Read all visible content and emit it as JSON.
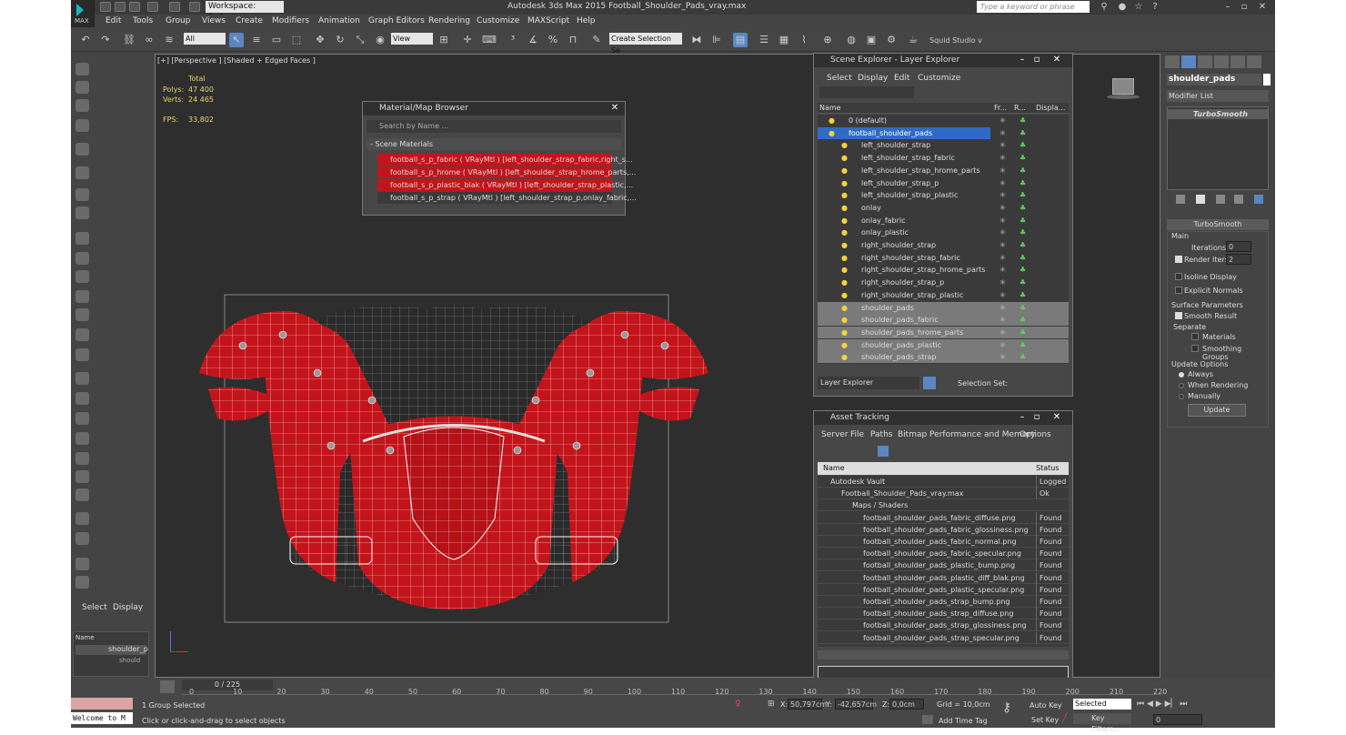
{
  "titlebar": {
    "workspace": "Workspace: Default",
    "title": "Autodesk 3ds Max  2015     Football_Shoulder_Pads_vray.max",
    "search_placeholder": "Type a keyword or phrase",
    "logo": "MAX"
  },
  "menu": [
    "Edit",
    "Tools",
    "Group",
    "Views",
    "Create",
    "Modifiers",
    "Animation",
    "Graph Editors",
    "Rendering",
    "Customize",
    "MAXScript",
    "Help"
  ],
  "toolbar": {
    "filter": "All",
    "view": "View",
    "selection_set": "Create Selection Se",
    "squid": "Squid Studio v"
  },
  "viewport": {
    "label": "[+] [Perspective ] [Shaded + Edged Faces ]",
    "stats": {
      "total_label": "Total",
      "polys_label": "Polys:",
      "polys": "47 400",
      "verts_label": "Verts:",
      "verts": "24 465",
      "fps_label": "FPS:",
      "fps": "33,802"
    }
  },
  "material_browser": {
    "title": "Material/Map Browser",
    "search_placeholder": "Search by Name ...",
    "section": "- Scene Materials",
    "items": [
      "football_s_p_fabric ( VRayMtl ) [left_shoulder_strap_fabric,right_s...",
      "football_s_p_hrome ( VRayMtl ) [left_shoulder_strap_hrome_parts,...",
      "football_s_p_plastic_blak ( VRayMtl ) [left_shoulder_strap_plastic,...",
      "football_s_p_strap ( VRayMtl ) [left_shoulder_strap_p,onlay_fabric,..."
    ]
  },
  "scene_explorer": {
    "title": "Scene Explorer - Layer Explorer",
    "menu": [
      "Select",
      "Display",
      "Edit",
      "Customize"
    ],
    "columns": [
      "Name",
      "Fr...",
      "R...",
      "Displa..."
    ],
    "rows": [
      "0 (default)",
      "football_shoulder_pads",
      "left_shoulder_strap",
      "left_shoulder_strap_fabric",
      "left_shoulder_strap_hrome_parts",
      "left_shoulder_strap_p",
      "left_shoulder_strap_plastic",
      "onlay",
      "onlay_fabric",
      "onlay_plastic",
      "right_shoulder_strap",
      "right_shoulder_strap_fabric",
      "right_shoulder_strap_hrome_parts",
      "right_shoulder_strap_p",
      "right_shoulder_strap_plastic",
      "shoulder_pads",
      "shoulder_pads_fabric",
      "shoulder_pads_hrome_parts",
      "shoulder_pads_plastic",
      "shoulder_pads_strap"
    ],
    "footer_left": "Layer Explorer",
    "footer_right": "Selection Set:"
  },
  "asset_tracking": {
    "title": "Asset Tracking",
    "menu": [
      "Server",
      "File",
      "Paths",
      "Bitmap Performance and Memory",
      "Options"
    ],
    "col_name": "Name",
    "col_status": "Status",
    "rows": [
      {
        "name": "Autodesk Vault",
        "status": "Logged C",
        "indent": 0
      },
      {
        "name": "Football_Shoulder_Pads_vray.max",
        "status": "Ok",
        "indent": 1
      },
      {
        "name": "Maps / Shaders",
        "status": "",
        "indent": 2
      },
      {
        "name": "football_shoulder_pads_fabric_diffuse.png",
        "status": "Found",
        "indent": 3
      },
      {
        "name": "football_shoulder_pads_fabric_glossiness.png",
        "status": "Found",
        "indent": 3
      },
      {
        "name": "football_shoulder_pads_fabric_normal.png",
        "status": "Found",
        "indent": 3
      },
      {
        "name": "football_shoulder_pads_fabric_specular.png",
        "status": "Found",
        "indent": 3
      },
      {
        "name": "football_shoulder_pads_plastic_bump.png",
        "status": "Found",
        "indent": 3
      },
      {
        "name": "football_shoulder_pads_plastic_diff_blak.png",
        "status": "Found",
        "indent": 3
      },
      {
        "name": "football_shoulder_pads_plastic_specular.png",
        "status": "Found",
        "indent": 3
      },
      {
        "name": "football_shoulder_pads_strap_bump.png",
        "status": "Found",
        "indent": 3
      },
      {
        "name": "football_shoulder_pads_strap_diffuse.png",
        "status": "Found",
        "indent": 3
      },
      {
        "name": "football_shoulder_pads_strap_glossiness.png",
        "status": "Found",
        "indent": 3
      },
      {
        "name": "football_shoulder_pads_strap_specular.png",
        "status": "Found",
        "indent": 3
      }
    ]
  },
  "modifier_panel": {
    "object_name": "shoulder_pads",
    "modifier_list": "Modifier List",
    "stack_item": "TurboSmooth",
    "rollout_title": "TurboSmooth",
    "main": "Main",
    "iterations_label": "Iterations:",
    "iterations": "0",
    "render_iters_label": "Render Iters:",
    "render_iters": "2",
    "isoline": "Isoline Display",
    "explicit": "Explicit Normals",
    "surface": "Surface Parameters",
    "smooth_result": "Smooth Result",
    "separate": "Separate",
    "materials": "Materials",
    "smoothing_groups": "Smoothing Groups",
    "update_options": "Update Options",
    "always": "Always",
    "when_rendering": "When Rendering",
    "manually": "Manually",
    "update": "Update"
  },
  "left_bottom": {
    "select": "Select",
    "display": "Display",
    "name_col": "Name",
    "item": "shoulder_p",
    "item2": "should"
  },
  "timeline": {
    "frame": "0 / 225",
    "ticks": [
      "0",
      "10",
      "20",
      "30",
      "40",
      "50",
      "60",
      "70",
      "80",
      "90",
      "100",
      "110",
      "120",
      "130",
      "140",
      "150",
      "160",
      "170",
      "180",
      "190",
      "200",
      "210",
      "220"
    ]
  },
  "status": {
    "selected": "1 Group Selected",
    "hint": "Click or click-and-drag to select objects",
    "welcome": "Welcome to M",
    "x": "50,797cm",
    "y": "-42,657cm",
    "z": "0,0cm",
    "grid": "Grid = 10,0cm",
    "add_time_tag": "Add Time Tag",
    "auto_key": "Auto Key",
    "set_key": "Set Key",
    "selected_dd": "Selected",
    "key_filters": "Key Filters...",
    "frame_field": "0"
  }
}
